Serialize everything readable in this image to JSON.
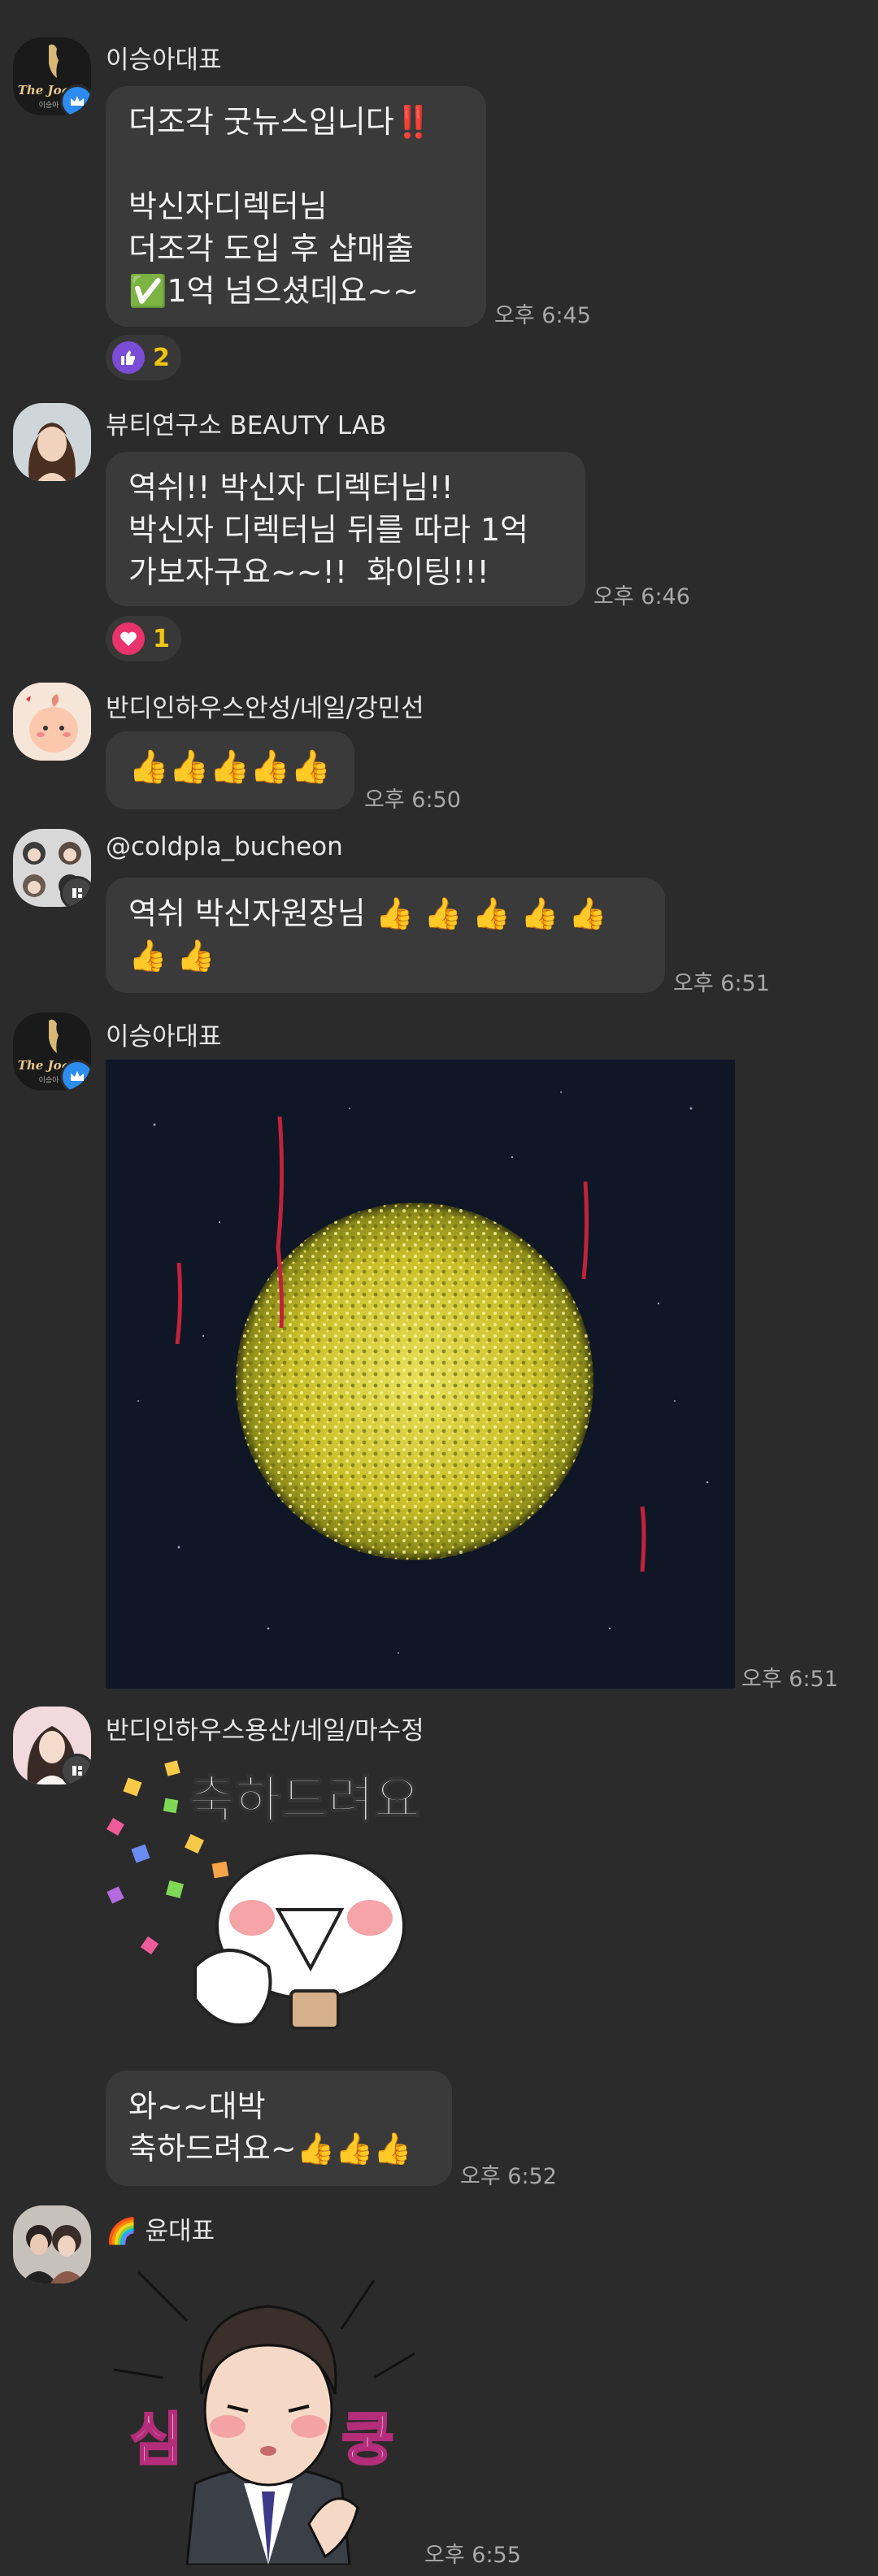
{
  "colors": {
    "background": "#2b2b2b",
    "bubble": "#3a3a3a",
    "time": "#a9a9a9",
    "reaction_count": "#f1c40f",
    "like_badge": "#7b4dd6",
    "heart_badge": "#e8336f",
    "owner_badge": "#2d8cf0"
  },
  "messages": [
    {
      "sender": "이승아대표",
      "avatar": "the-jogak-logo",
      "avatar_text": "The Jogak",
      "badge": "crown-icon",
      "text": "더조각 굿뉴스입니다‼️\n\n박신자디렉터님\n더조각 도입 후 샵매출\n✅1억 넘으셨데요~~",
      "time": "오후 6:45",
      "reaction": {
        "icon": "thumbs-up-icon",
        "count": "2"
      }
    },
    {
      "sender": "뷰티연구소 BEAUTY LAB",
      "avatar": "woman-portrait",
      "text": "역쉬!! 박신자 디렉터님!!\n박신자 디렉터님 뒤를 따라 1억\n가보자구요~~!!  화이팅!!!",
      "time": "오후 6:46",
      "reaction": {
        "icon": "heart-icon",
        "count": "1"
      }
    },
    {
      "sender": "반디인하우스안성/네일/강민선",
      "avatar": "peach-character",
      "text": "👍👍👍👍👍",
      "time": "오후 6:50"
    },
    {
      "sender": "@coldpla_bucheon",
      "avatar": "group-photo",
      "badge": "profile-card-icon",
      "text": "역쉬 박신자원장님 👍 👍 👍 👍 👍\n👍 👍",
      "time": "오후 6:51"
    },
    {
      "sender": "이승아대표",
      "avatar": "the-jogak-logo",
      "avatar_text": "The Jogak",
      "badge": "crown-icon",
      "image": "golden-sphere-photo",
      "time": "오후 6:51"
    },
    {
      "sender": "반디인하우스용산/네일/마수정",
      "avatar": "woman-portrait-2",
      "badge": "profile-card-icon",
      "sticker": {
        "name": "congrats-sticker",
        "text": "축하드려요"
      },
      "text": "와~~대박\n축하드려요~👍👍👍",
      "time": "오후 6:52"
    },
    {
      "sender": "🌈 윤대표",
      "avatar": "couple-photo",
      "sticker": {
        "name": "heart-flutter-sticker",
        "left": "심",
        "right": "쿵"
      },
      "time": "오후 6:55"
    }
  ]
}
